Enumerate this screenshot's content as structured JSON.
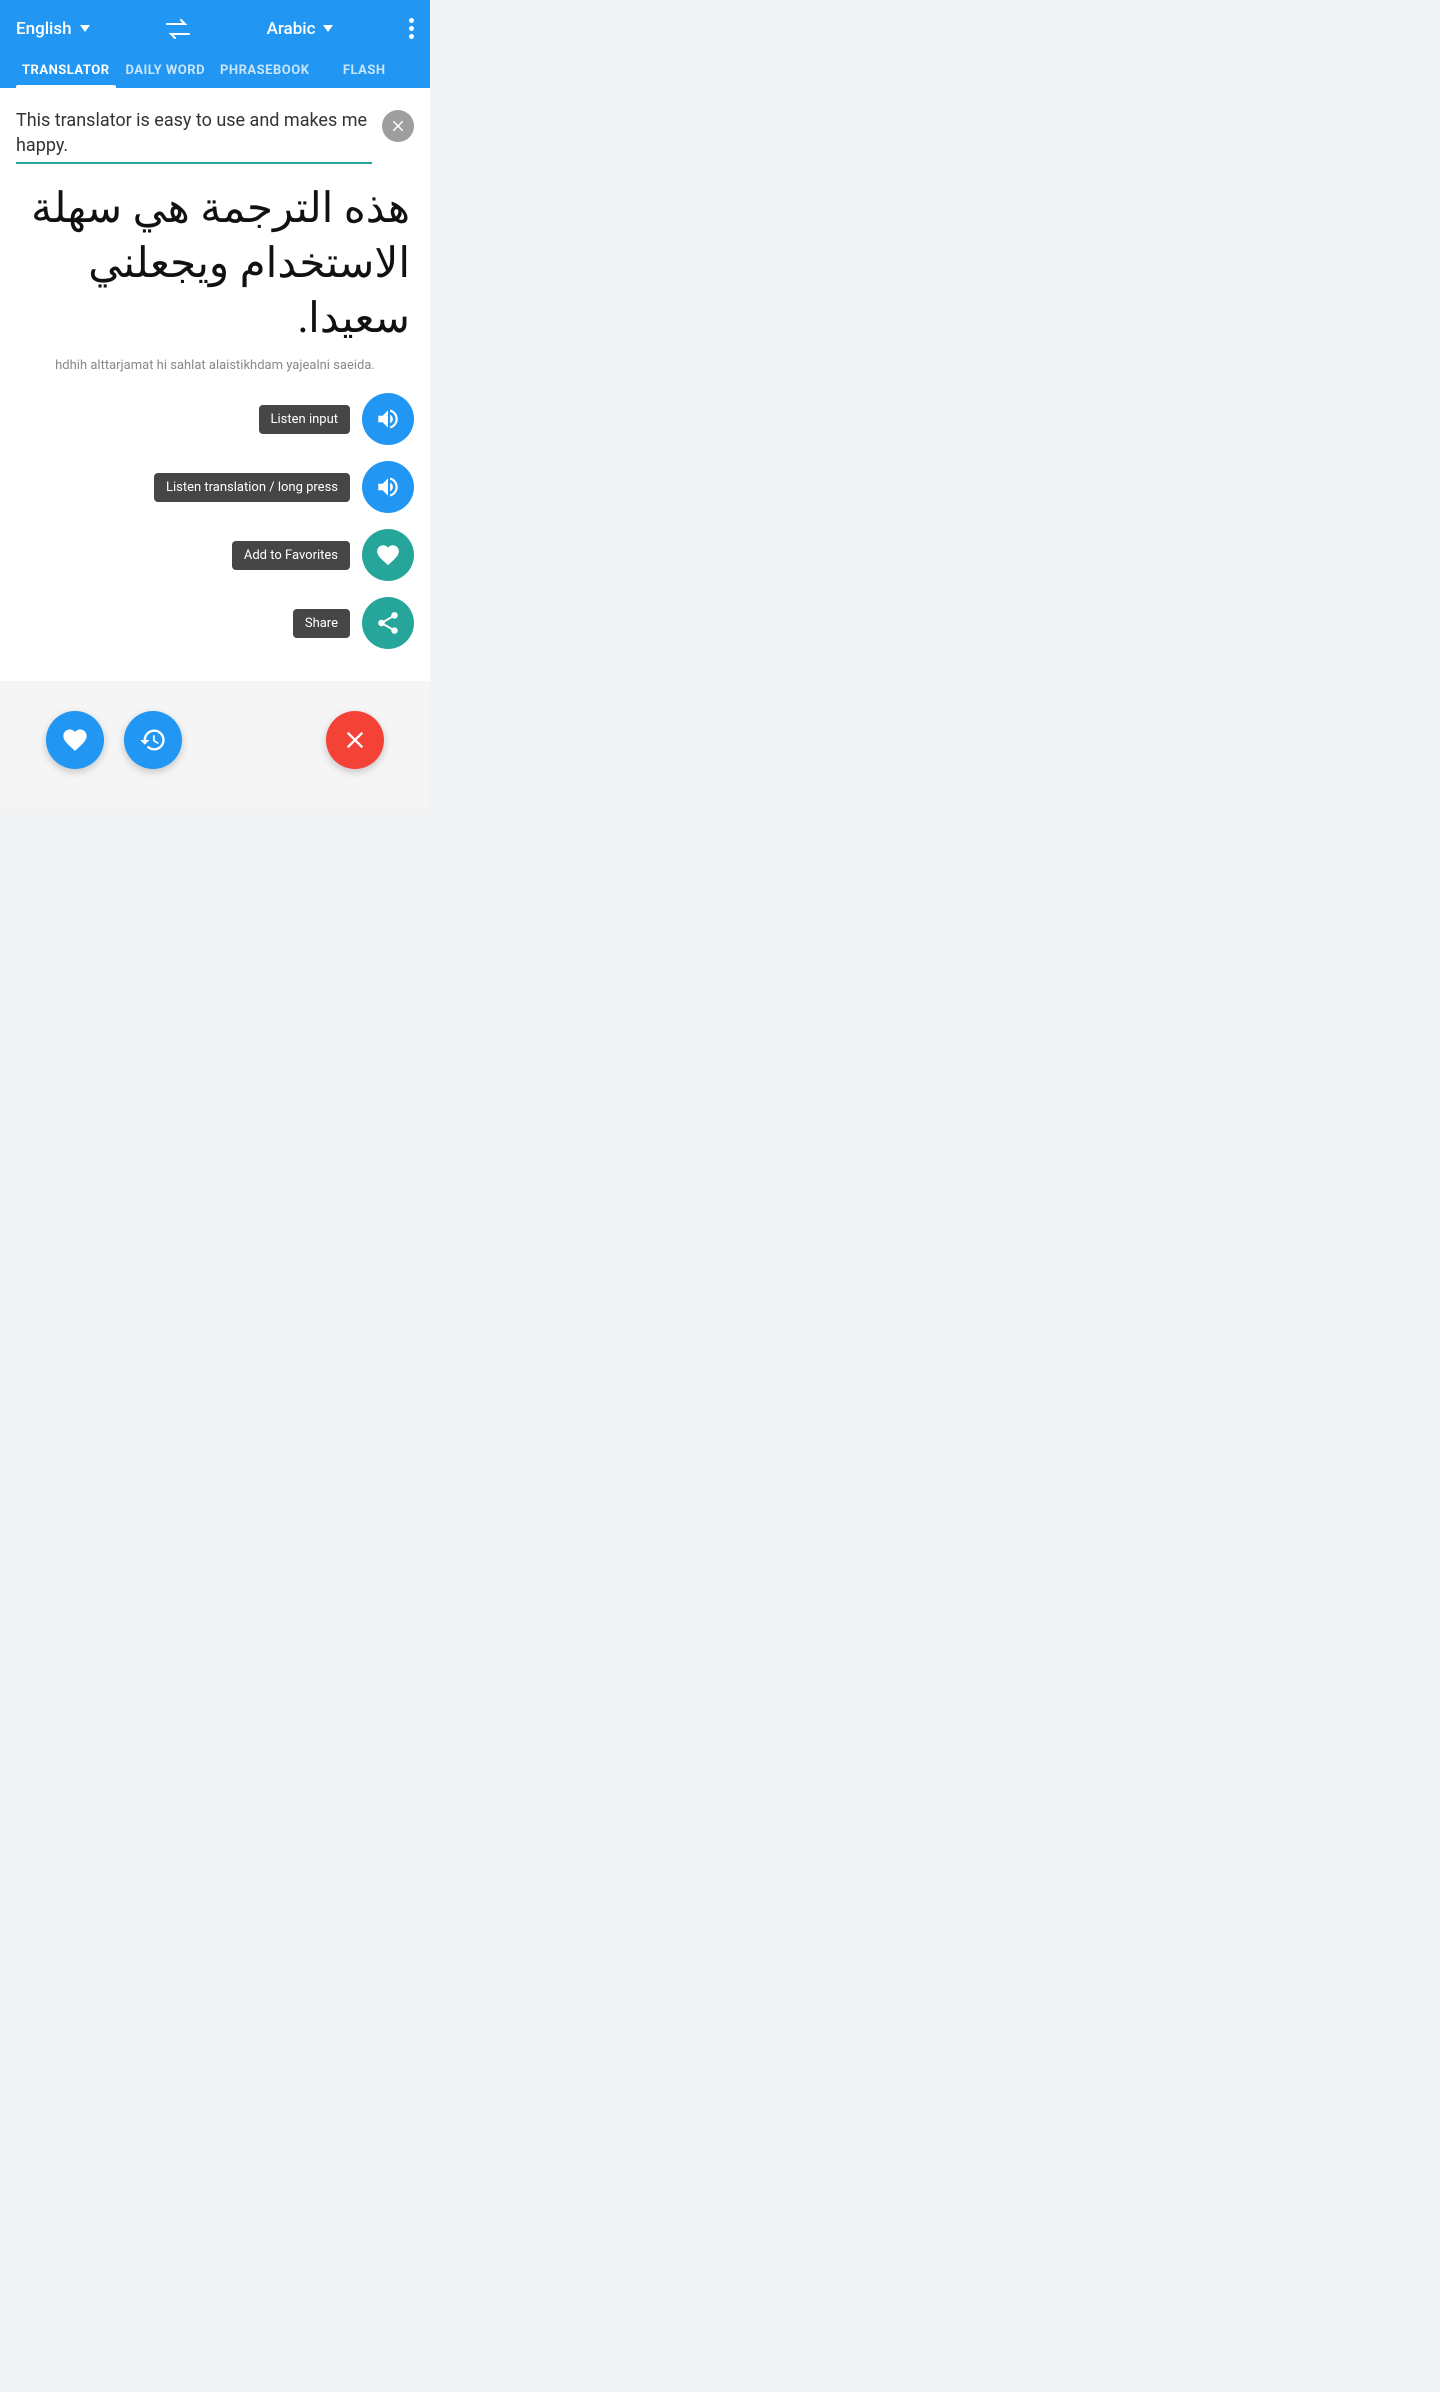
{
  "header": {
    "source_lang": "English",
    "target_lang": "Arabic",
    "more_label": "more options"
  },
  "tabs": [
    {
      "id": "translator",
      "label": "TRANSLATOR",
      "active": true
    },
    {
      "id": "daily-word",
      "label": "DAILY WORD",
      "active": false
    },
    {
      "id": "phrasebook",
      "label": "PHRASEBOOK",
      "active": false
    },
    {
      "id": "flash",
      "label": "FLASH",
      "active": false
    }
  ],
  "translator": {
    "input_text": "This translator is easy to use and makes me happy.",
    "translated_arabic": "هذه الترجمة هي سهلة الاستخدام ويجعلني سعيدا.",
    "transliteration": "hdhih alttarjamat hi sahlat alaistikhdam yajealni saeida.",
    "clear_button_label": "clear input",
    "listen_input_tooltip": "Listen input",
    "listen_translation_tooltip": "Listen translation / long press",
    "add_favorites_tooltip": "Add to Favorites",
    "share_tooltip": "Share"
  },
  "bottom_bar": {
    "favorites_label": "favorites",
    "history_label": "history",
    "close_label": "close"
  },
  "colors": {
    "blue": "#2196F3",
    "teal": "#26A69A",
    "red": "#F44336",
    "dark_tooltip": "rgba(50,50,50,0.9)"
  }
}
